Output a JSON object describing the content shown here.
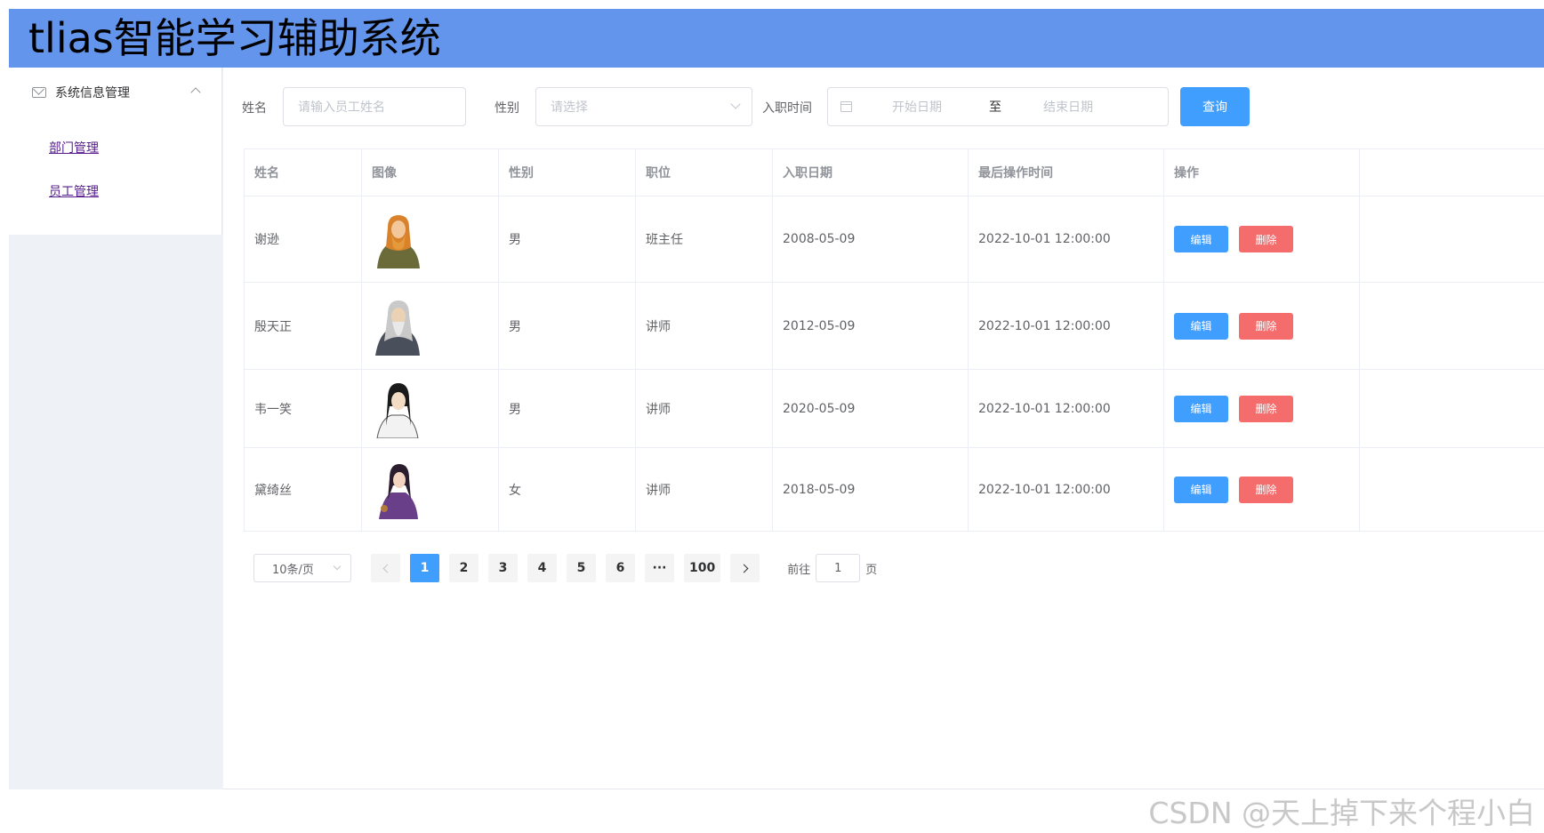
{
  "header": {
    "title": "tlias智能学习辅助系统"
  },
  "sidebar": {
    "group_label": "系统信息管理",
    "items": [
      {
        "label": "部门管理"
      },
      {
        "label": "员工管理"
      }
    ]
  },
  "search": {
    "name_label": "姓名",
    "name_placeholder": "请输入员工姓名",
    "gender_label": "性别",
    "gender_placeholder": "请选择",
    "date_label": "入职时间",
    "start_placeholder": "开始日期",
    "range_separator": "至",
    "end_placeholder": "结束日期",
    "query_label": "查询"
  },
  "table": {
    "headers": [
      "姓名",
      "图像",
      "性别",
      "职位",
      "入职日期",
      "最后操作时间",
      "操作"
    ],
    "rows": [
      {
        "name": "谢逊",
        "gender": "男",
        "job": "班主任",
        "entry": "2008-05-09",
        "updated": "2022-10-01 12:00:00"
      },
      {
        "name": "殷天正",
        "gender": "男",
        "job": "讲师",
        "entry": "2012-05-09",
        "updated": "2022-10-01 12:00:00"
      },
      {
        "name": "韦一笑",
        "gender": "男",
        "job": "讲师",
        "entry": "2020-05-09",
        "updated": "2022-10-01 12:00:00"
      },
      {
        "name": "黛绮丝",
        "gender": "女",
        "job": "讲师",
        "entry": "2018-05-09",
        "updated": "2022-10-01 12:00:00"
      }
    ],
    "edit_label": "编辑",
    "delete_label": "删除"
  },
  "pagination": {
    "page_size": "10条/页",
    "pages": [
      "1",
      "2",
      "3",
      "4",
      "5",
      "6",
      "···",
      "100"
    ],
    "current": "1",
    "goto_prefix": "前往",
    "goto_value": "1",
    "goto_suffix": "页"
  },
  "watermark": "CSDN @天上掉下来个程小白",
  "colors": {
    "header": "#6495ed",
    "primary": "#409eff",
    "danger": "#f56c6c"
  }
}
